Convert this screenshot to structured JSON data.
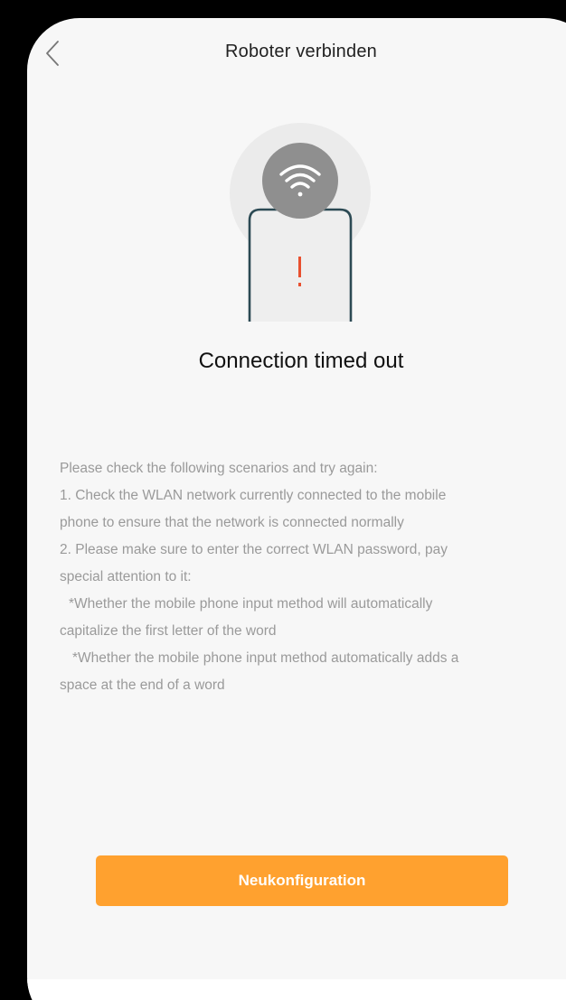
{
  "header": {
    "title": "Roboter verbinden",
    "back_icon": "chevron-left-icon"
  },
  "illustration": {
    "icons": [
      "wifi-icon",
      "phone-icon",
      "exclamation-icon"
    ],
    "colors": {
      "halo": "#ebebeb",
      "wifi_circle": "#8f8f8f",
      "phone_outline": "#2c4a54",
      "phone_fill": "#eeeeee",
      "alert": "#e8502f"
    }
  },
  "status": {
    "heading": "Connection timed out"
  },
  "instructions": {
    "lines": [
      "Please check the following scenarios and try again:",
      "1. Check the WLAN network currently connected to the mobile",
      "phone to ensure that the network is connected normally",
      "2. Please make sure to enter the correct WLAN password, pay",
      "special attention to it:",
      "*Whether the mobile phone input method will automatically",
      "capitalize the first letter of the word",
      "*Whether the mobile phone input method automatically adds a",
      "space at the end of a word"
    ]
  },
  "actions": {
    "reconfigure_label": "Neukonfiguration"
  },
  "colors": {
    "accent": "#ffa12f",
    "background": "#f7f7f7",
    "text_primary": "#111111",
    "text_secondary": "#9a9a9a"
  }
}
